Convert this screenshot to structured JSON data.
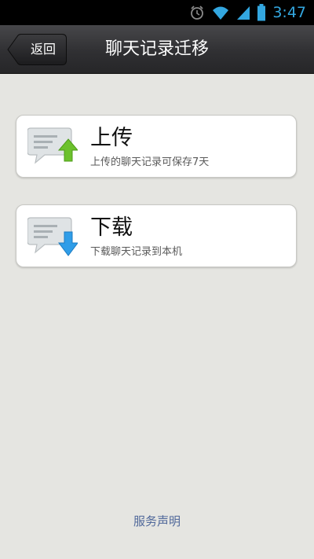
{
  "status_bar": {
    "time": "3:47",
    "icons": [
      "alarm-icon",
      "wifi-icon",
      "signal-icon",
      "battery-icon"
    ],
    "accent_color": "#33a7e0"
  },
  "header": {
    "back_label": "返回",
    "title": "聊天记录迁移"
  },
  "options": [
    {
      "title": "上传",
      "subtitle": "上传的聊天记录可保存7天",
      "icon": "chat-upload-icon",
      "arrow_color": "#6cc12c"
    },
    {
      "title": "下载",
      "subtitle": "下载聊天记录到本机",
      "icon": "chat-download-icon",
      "arrow_color": "#2f9de8"
    }
  ],
  "footer": {
    "link_label": "服务声明"
  }
}
